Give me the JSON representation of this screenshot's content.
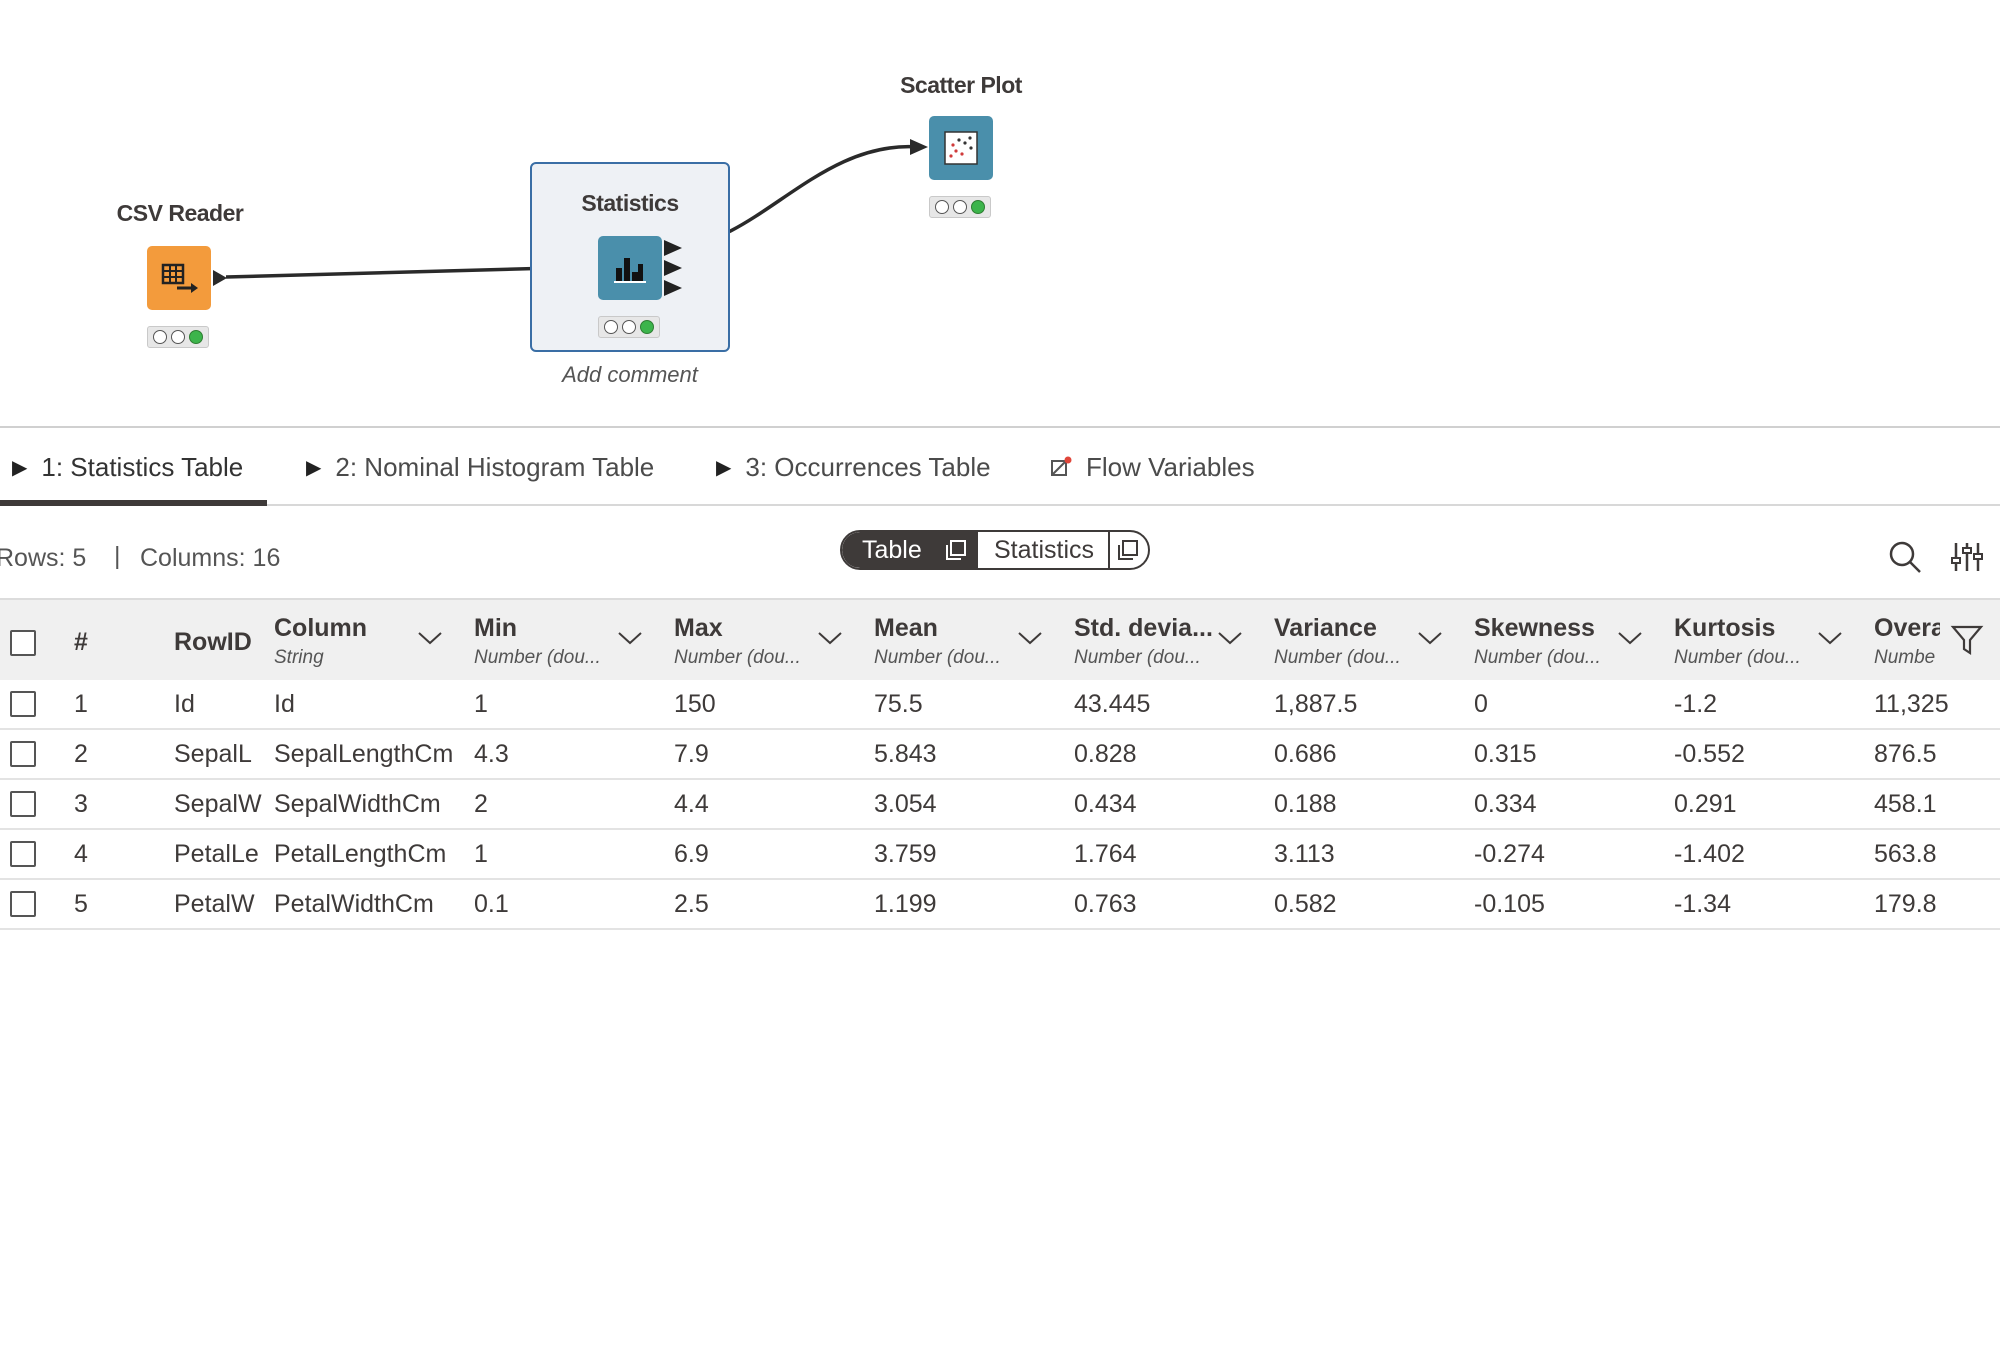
{
  "workflow": {
    "nodes": [
      {
        "label": "CSV Reader",
        "type": "reader",
        "color": "#f39b3c"
      },
      {
        "label": "Statistics",
        "type": "statistics",
        "color": "#4a8fab"
      },
      {
        "label": "Scatter Plot",
        "type": "view",
        "color": "#4a8fab"
      }
    ],
    "add_comment": "Add comment"
  },
  "tabs": [
    {
      "label": "1: Statistics Table",
      "icon": "play-triangle-icon",
      "active": true
    },
    {
      "label": "2: Nominal Histogram Table",
      "icon": "play-triangle-icon",
      "active": false
    },
    {
      "label": "3: Occurrences Table",
      "icon": "play-triangle-icon",
      "active": false
    },
    {
      "label": "Flow Variables",
      "icon": "flow-variable-icon",
      "active": false
    }
  ],
  "info": {
    "rows": "Rows: 5",
    "separator": "|",
    "columns": "Columns: 16"
  },
  "view_toggle": {
    "table_label": "Table",
    "statistics_label": "Statistics"
  },
  "table": {
    "index_header": "#",
    "rowid_header": "RowID",
    "columns": [
      {
        "name": "Column",
        "type": "String"
      },
      {
        "name": "Min",
        "type": "Number (dou..."
      },
      {
        "name": "Max",
        "type": "Number (dou..."
      },
      {
        "name": "Mean",
        "type": "Number (dou..."
      },
      {
        "name": "Std. devia...",
        "type": "Number (dou..."
      },
      {
        "name": "Variance",
        "type": "Number (dou..."
      },
      {
        "name": "Skewness",
        "type": "Number (dou..."
      },
      {
        "name": "Kurtosis",
        "type": "Number (dou..."
      },
      {
        "name": "Overa",
        "type": "Numbe"
      }
    ],
    "rows": [
      {
        "index": "1",
        "rowid": "Id",
        "cells": [
          "Id",
          "1",
          "150",
          "75.5",
          "43.445",
          "1,887.5",
          "0",
          "-1.2",
          "11,325"
        ]
      },
      {
        "index": "2",
        "rowid": "SepalL",
        "cells": [
          "SepalLengthCm",
          "4.3",
          "7.9",
          "5.843",
          "0.828",
          "0.686",
          "0.315",
          "-0.552",
          "876.5"
        ]
      },
      {
        "index": "3",
        "rowid": "SepalW",
        "cells": [
          "SepalWidthCm",
          "2",
          "4.4",
          "3.054",
          "0.434",
          "0.188",
          "0.334",
          "0.291",
          "458.1"
        ]
      },
      {
        "index": "4",
        "rowid": "PetalLe",
        "cells": [
          "PetalLengthCm",
          "1",
          "6.9",
          "3.759",
          "1.764",
          "3.113",
          "-0.274",
          "-1.402",
          "563.8"
        ]
      },
      {
        "index": "5",
        "rowid": "PetalW",
        "cells": [
          "PetalWidthCm",
          "0.1",
          "2.5",
          "1.199",
          "0.763",
          "0.582",
          "-0.105",
          "-1.34",
          "179.8"
        ]
      }
    ]
  },
  "colors": {
    "accent_dark": "#3e3a39",
    "reader_orange": "#f39b3c",
    "node_blue": "#4a8fab",
    "status_green": "#3cb44b",
    "selection_blue": "#3a6ea5"
  }
}
